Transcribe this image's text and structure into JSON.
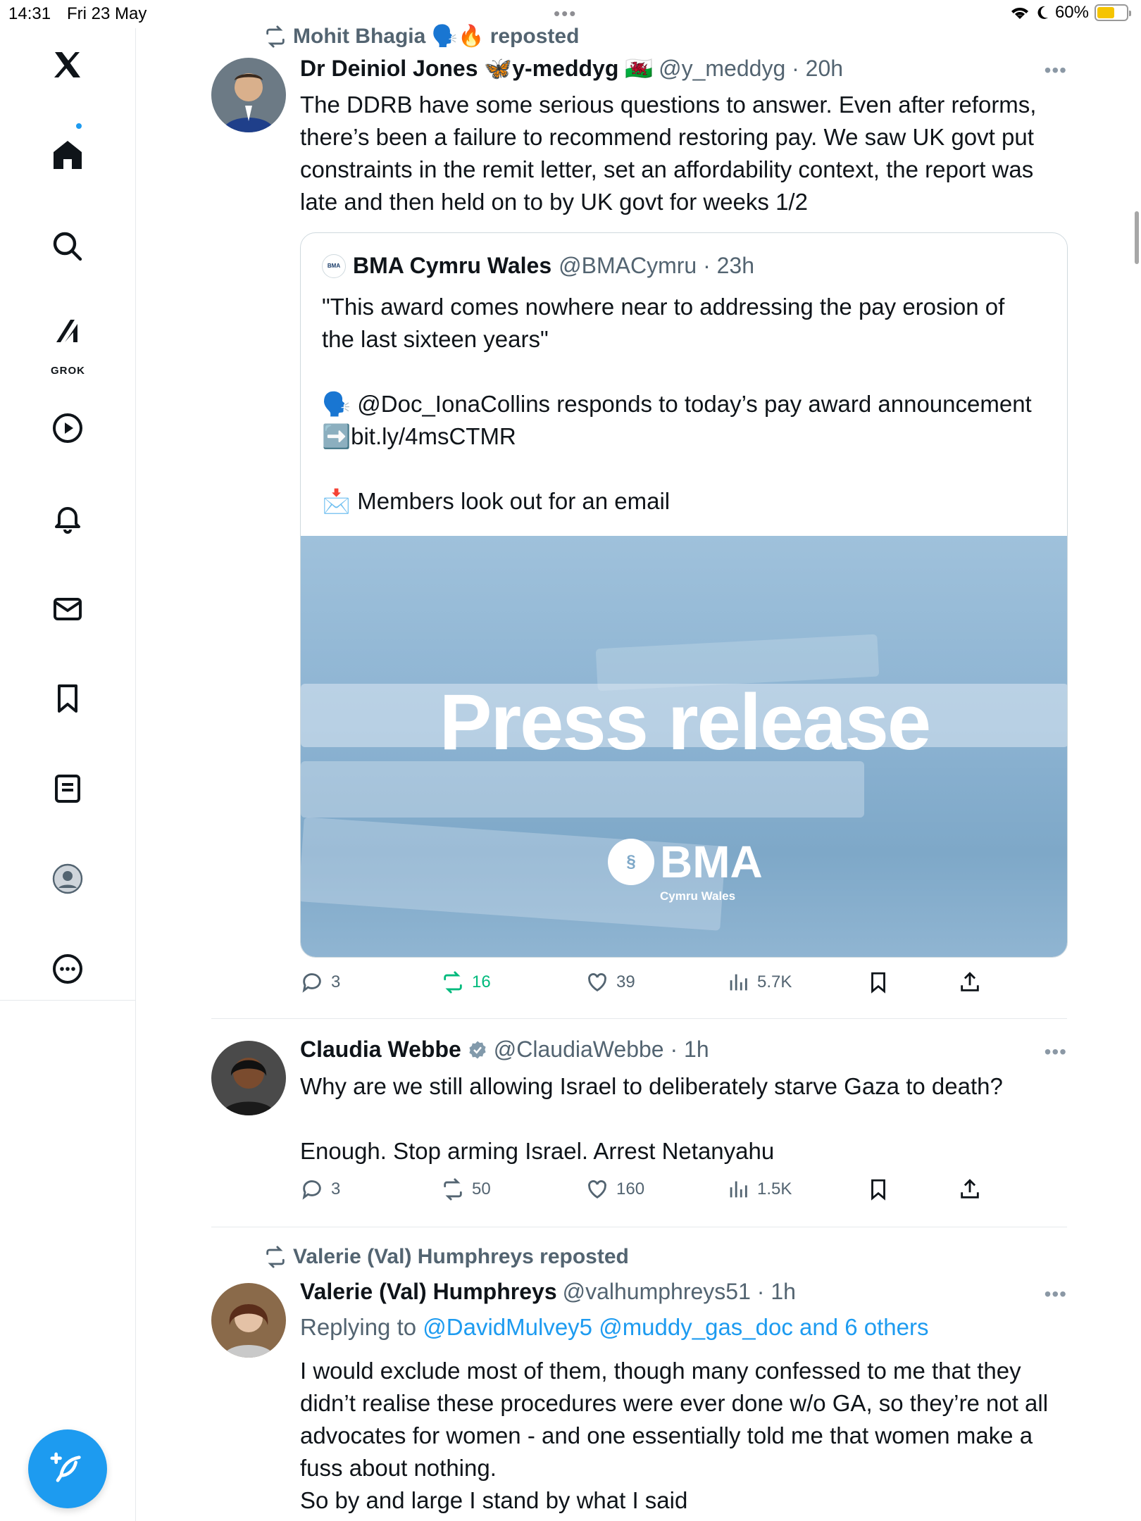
{
  "status_bar": {
    "time": "14:31",
    "date": "Fri 23 May",
    "battery": "60%",
    "battery_level": 0.6
  },
  "sidebar": {
    "items": [
      {
        "name": "x-logo-icon"
      },
      {
        "name": "home-icon"
      },
      {
        "name": "search-icon"
      },
      {
        "name": "grok-icon",
        "label": "GROK"
      },
      {
        "name": "video-icon"
      },
      {
        "name": "notifications-icon"
      },
      {
        "name": "messages-icon"
      },
      {
        "name": "bookmarks-icon"
      },
      {
        "name": "lists-icon"
      },
      {
        "name": "profile-icon"
      },
      {
        "name": "more-icon"
      }
    ]
  },
  "posts": [
    {
      "repost_by": "Mohit Bhagia 🗣️🔥 reposted",
      "author_name": "Dr Deiniol Jones 🦋y-meddyg 🏴󠁧󠁢󠁷󠁬󠁳󠁿",
      "handle_time": "@y_meddyg · 20h",
      "text": "The DDRB have some serious questions to answer. Even after reforms, there’s been a failure to recommend restoring pay. We saw UK govt put constraints in the remit letter, set an affordability context, the report was late and then held on to by UK govt for weeks 1/2",
      "quote": {
        "logo_text": "BMA",
        "author_name": "BMA Cymru Wales",
        "handle_time": "@BMACymru · 23h",
        "text": "\"This award comes nowhere near to addressing the pay erosion of the last sixteen years\"\n\n🗣️ @Doc_IonaCollins responds to today’s pay award announcement ➡️bit.ly/4msCTMR\n\n📩 Members look out for an email",
        "image_title": "Press release",
        "image_logo": "BMA",
        "image_logo_sub": "Cymru Wales"
      },
      "replies": "3",
      "reposts": "16",
      "likes": "39",
      "views": "5.7K"
    },
    {
      "author_name": "Claudia Webbe",
      "handle_time": "@ClaudiaWebbe · 1h",
      "text": "Why are we still allowing Israel to deliberately starve Gaza to death?\n\nEnough. Stop arming Israel. Arrest Netanyahu",
      "replies": "3",
      "reposts": "50",
      "likes": "160",
      "views": "1.5K"
    },
    {
      "repost_by": "Valerie (Val) Humphreys reposted",
      "author_name": "Valerie (Val) Humphreys",
      "handle_time": "@valhumphreys51 · 1h",
      "reply_prefix": "Replying to",
      "reply_links": "@DavidMulvey5 @muddy_gas_doc and 6 others",
      "text": "I would exclude most of them, though many confessed to me that they didn’t realise these procedures were ever done w/o GA, so they’re not all advocates for women - and one essentially told me that women make a fuss about nothing.\nSo by and large I stand by what I said"
    }
  ],
  "more_label": "•••",
  "colors": {
    "accent": "#1d9bf0",
    "repost_green": "#00ba7c",
    "muted": "#536471"
  }
}
